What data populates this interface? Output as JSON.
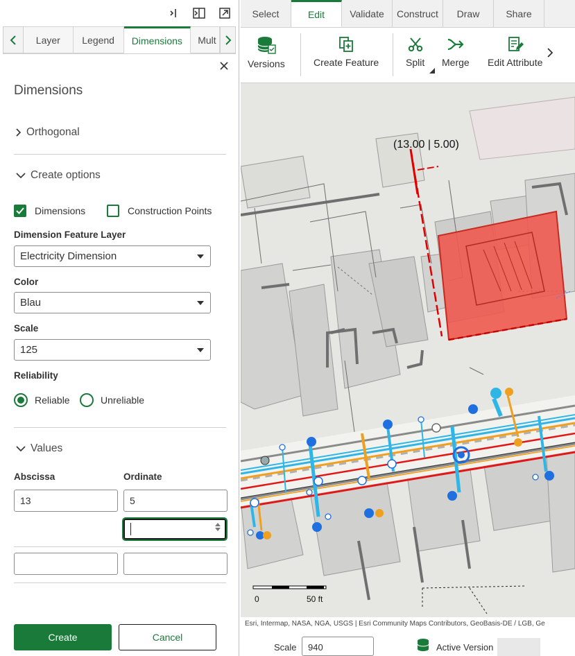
{
  "panel_tabs": [
    "Layer",
    "Legend",
    "Dimensions",
    "Mult"
  ],
  "active_panel_tab": "Dimensions",
  "panel": {
    "title": "Dimensions",
    "orthogonal_label": "Orthogonal",
    "create_options_label": "Create options",
    "dimensions_checkbox": "Dimensions",
    "construction_points_checkbox": "Construction Points",
    "dimension_feature_layer_label": "Dimension Feature Layer",
    "dimension_feature_layer_value": "Electricity Dimension",
    "color_label": "Color",
    "color_value": "Blau",
    "scale_label": "Scale",
    "scale_value": "125",
    "reliability_label": "Reliability",
    "reliable_label": "Reliable",
    "unreliable_label": "Unreliable",
    "values_label": "Values",
    "abscissa_label": "Abscissa",
    "ordinate_label": "Ordinate",
    "abscissa_value": "13",
    "ordinate_value": "5",
    "create_button": "Create",
    "cancel_button": "Cancel"
  },
  "ribbon_tabs": [
    "Select",
    "Edit",
    "Validate",
    "Construct",
    "Draw",
    "Share"
  ],
  "active_ribbon_tab": "Edit",
  "ribbon": {
    "versions": "Versions",
    "create_feature": "Create Feature",
    "split": "Split",
    "merge": "Merge",
    "edit_attribute": "Edit Attribute"
  },
  "map": {
    "dimension_label": "(13.00 | 5.00)",
    "scalebar_start": "0",
    "scalebar_end": "50 ft",
    "attribution": "Esri, Intermap, NASA, NGA, USGS | Esri Community Maps Contributors, GeoBasis-DE / LGB, Ge"
  },
  "status": {
    "scale_label": "Scale",
    "scale_value": "940",
    "active_version_label": "Active Version"
  },
  "colors": {
    "accent": "#1a7a3a",
    "selection_red": "#e8453c",
    "pipe_blue": "#1f6fe0",
    "pipe_cyan": "#2fb6e6",
    "pipe_orange": "#f0a020",
    "line_red": "#e01818"
  }
}
